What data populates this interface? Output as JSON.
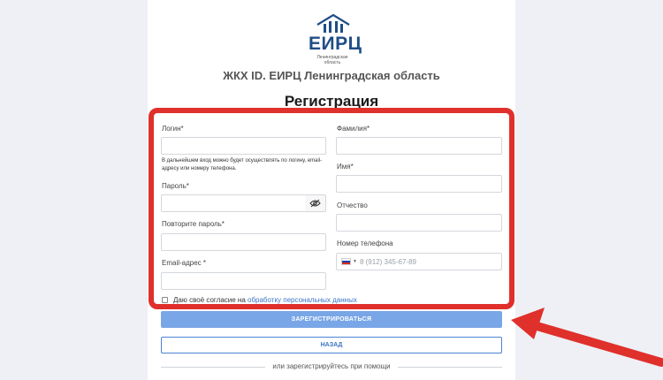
{
  "header": {
    "logo_text": "ЕИРЦ",
    "logo_subtext": "Ленинградская область",
    "org_title": "ЖКХ ID. ЕИРЦ Ленинградская область",
    "page_title": "Регистрация"
  },
  "form": {
    "login_label": "Логин*",
    "login_hint": "В дальнейшем вход можно будет осуществлять по логину, email-адресу или номеру телефона.",
    "password_label": "Пароль*",
    "repeat_password_label": "Повторите пароль*",
    "email_label": "Email-адрес *",
    "lastname_label": "Фамилия*",
    "firstname_label": "Имя*",
    "middlename_label": "Отчество",
    "phone_label": "Номер телефона",
    "phone_placeholder": "8 (912) 345-67-89",
    "consent_text": "Даю своё согласие на ",
    "consent_link": "обработку персональных данных",
    "register_button": "ЗАРЕГИСТРИРОВАТЬСЯ",
    "back_button": "НАЗАД",
    "divider_text": "или зарегистрируйтесь при помощи"
  },
  "colors": {
    "accent": "#79a6e6",
    "link": "#3d73c6",
    "highlight": "#e0302c",
    "brand": "#1f4d86"
  }
}
